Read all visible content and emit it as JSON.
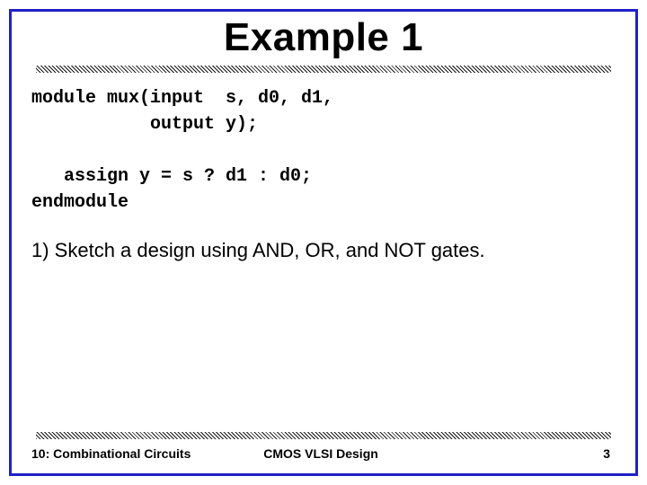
{
  "slide": {
    "title": "Example 1",
    "code_line1": "module mux(input  s, d0, d1,",
    "code_line2": "           output y);",
    "code_line3": "",
    "code_line4": "   assign y = s ? d1 : d0;",
    "code_line5": "endmodule",
    "question": "1) Sketch a design using AND, OR, and NOT gates."
  },
  "footer": {
    "left": "10: Combinational Circuits",
    "center": "CMOS VLSI Design",
    "right": "3"
  }
}
